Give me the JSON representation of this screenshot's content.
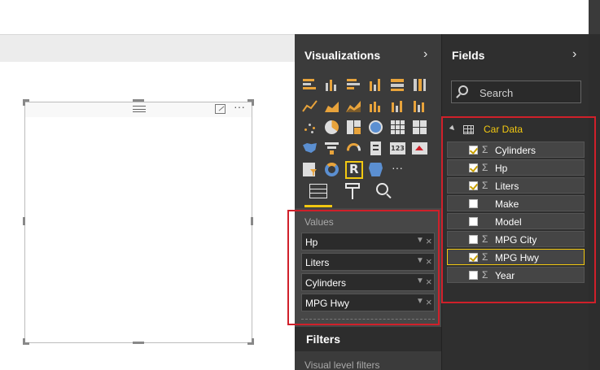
{
  "visualizations": {
    "title": "Visualizations",
    "values_label": "Values",
    "wells": [
      "Hp",
      "Liters",
      "Cylinders",
      "MPG Hwy"
    ],
    "more_label": "···"
  },
  "filters": {
    "title": "Filters",
    "visual_level": "Visual level filters"
  },
  "fields": {
    "title": "Fields",
    "search_placeholder": "Search",
    "table": "Car Data",
    "items": [
      {
        "name": "Cylinders",
        "checked": true,
        "sigma": true
      },
      {
        "name": "Hp",
        "checked": true,
        "sigma": true
      },
      {
        "name": "Liters",
        "checked": true,
        "sigma": true
      },
      {
        "name": "Make",
        "checked": false,
        "sigma": false
      },
      {
        "name": "Model",
        "checked": false,
        "sigma": false
      },
      {
        "name": "MPG City",
        "checked": false,
        "sigma": true
      },
      {
        "name": "MPG Hwy",
        "checked": true,
        "sigma": true
      },
      {
        "name": "Year",
        "checked": false,
        "sigma": true
      }
    ]
  },
  "colors": {
    "accent": "#f2c811",
    "highlight": "#d0202a",
    "pane_dark": "#2f2f2f"
  }
}
